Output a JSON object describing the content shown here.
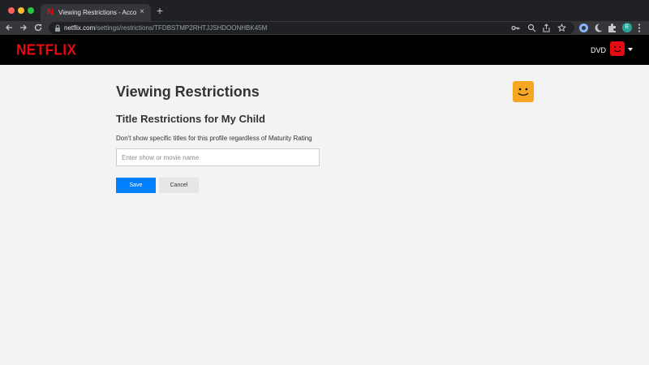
{
  "browser": {
    "tab_title": "Viewing Restrictions - Account",
    "tab_favicon": "N",
    "tab_close": "×",
    "new_tab": "+",
    "url_host": "netflix.com",
    "url_path": "/settings/restrictions/TFDBSTMP2RHTJJSHDOONHBK45M",
    "profile_initial": "E"
  },
  "header": {
    "logo": "NETFLIX",
    "profile_name": "DVD"
  },
  "main": {
    "title": "Viewing Restrictions",
    "section_title": "Title Restrictions for My Child",
    "description": "Don't show specific titles for this profile regardless of Maturity Rating",
    "search_placeholder": "Enter show or movie name",
    "search_value": "",
    "save_label": "Save",
    "cancel_label": "Cancel"
  },
  "colors": {
    "brand": "#e50914",
    "primary_button": "#0080ff",
    "profile_icon": "#f5a623"
  }
}
